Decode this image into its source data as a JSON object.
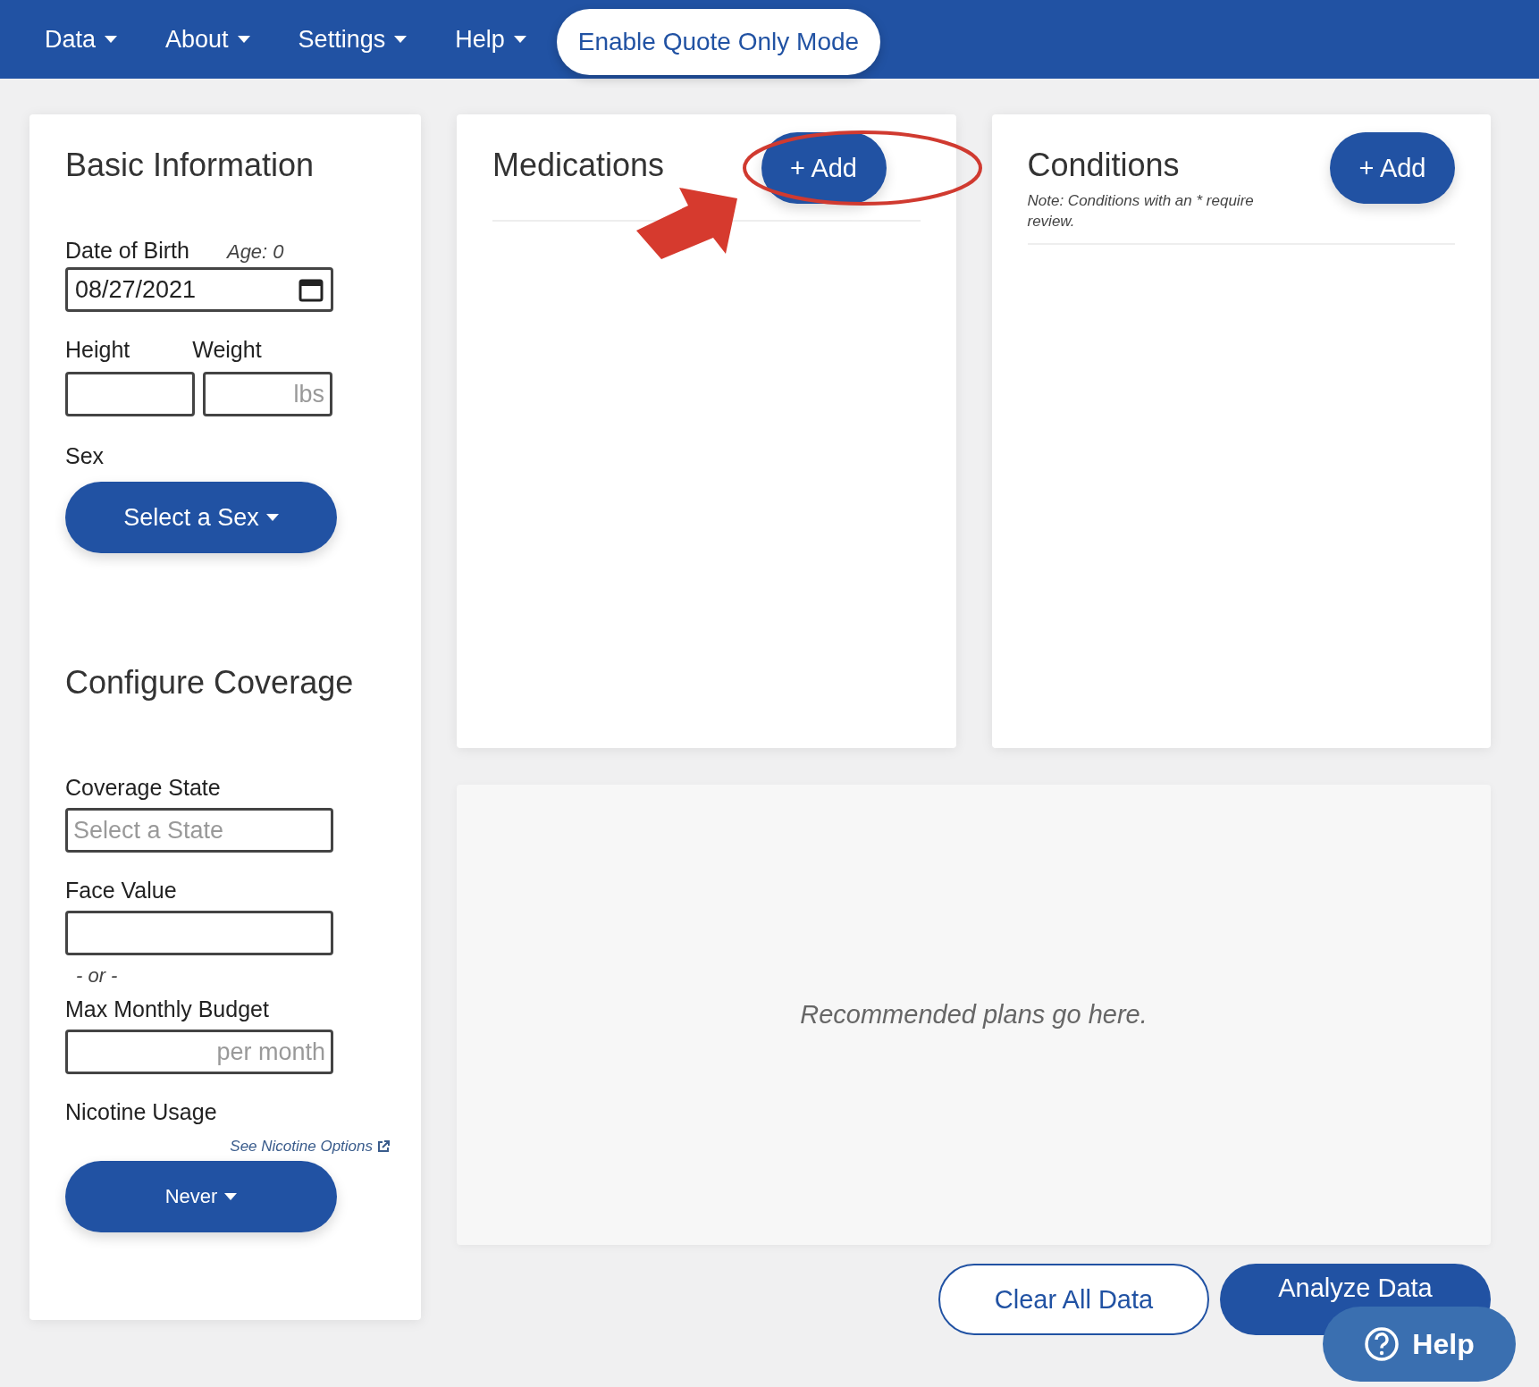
{
  "nav": {
    "menus": [
      {
        "label": "Data"
      },
      {
        "label": "About"
      },
      {
        "label": "Settings"
      },
      {
        "label": "Help"
      }
    ],
    "quote_mode_button": "Enable Quote Only Mode"
  },
  "basic_information": {
    "title": "Basic Information",
    "dob_label": "Date of Birth",
    "age": "Age: 0",
    "dob_value": "08/27/2021",
    "height_label": "Height",
    "weight_label": "Weight",
    "weight_placeholder": "lbs",
    "sex_label": "Sex",
    "sex_button": "Select a Sex"
  },
  "configure_coverage": {
    "title": "Configure Coverage",
    "state_label": "Coverage State",
    "state_placeholder": "Select a State",
    "face_value_label": "Face Value",
    "or_text": "- or -",
    "budget_label": "Max Monthly Budget",
    "budget_placeholder": "per month",
    "nicotine_label": "Nicotine Usage",
    "nicotine_link": "See Nicotine Options",
    "nicotine_button": "Never"
  },
  "medications": {
    "title": "Medications",
    "add_button": "+ Add"
  },
  "conditions": {
    "title": "Conditions",
    "add_button": "+ Add",
    "note": "Note: Conditions with an * require review."
  },
  "recommendations": {
    "placeholder": "Recommended plans go here."
  },
  "actions": {
    "clear_button": "Clear All Data",
    "analyze_button": "Analyze Data"
  },
  "help_button": "Help"
}
